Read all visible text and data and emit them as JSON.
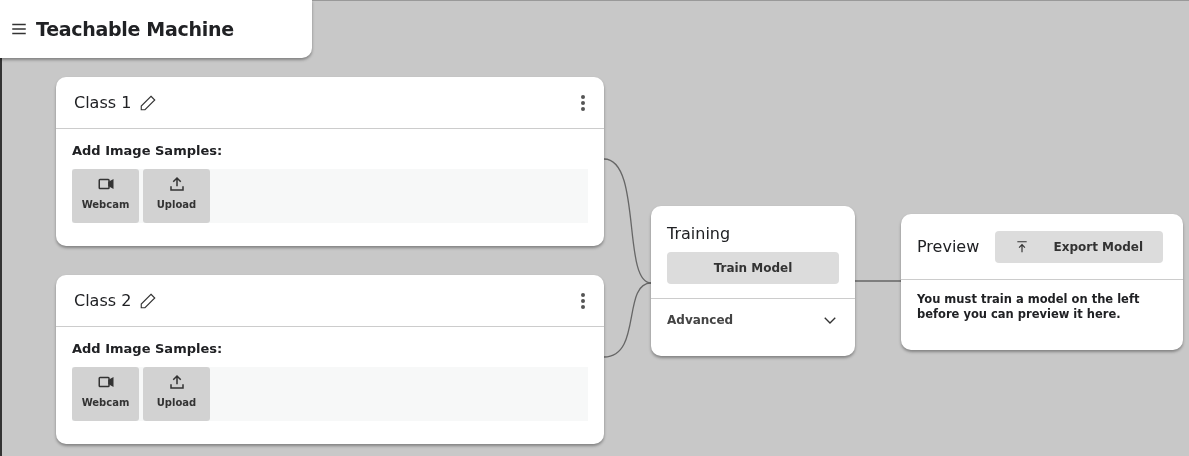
{
  "app": {
    "title": "Teachable Machine"
  },
  "classes": [
    {
      "name": "Class 1",
      "samples_label": "Add Image Samples:",
      "sources": [
        {
          "kind": "webcam",
          "label": "Webcam"
        },
        {
          "kind": "upload",
          "label": "Upload"
        }
      ]
    },
    {
      "name": "Class 2",
      "samples_label": "Add Image Samples:",
      "sources": [
        {
          "kind": "webcam",
          "label": "Webcam"
        },
        {
          "kind": "upload",
          "label": "Upload"
        }
      ]
    }
  ],
  "training": {
    "title": "Training",
    "button": "Train Model",
    "advanced": {
      "label": "Advanced",
      "expanded": false
    }
  },
  "preview": {
    "title": "Preview",
    "export_button": "Export Model",
    "message": "You must train a model on the left before you can preview it here."
  }
}
